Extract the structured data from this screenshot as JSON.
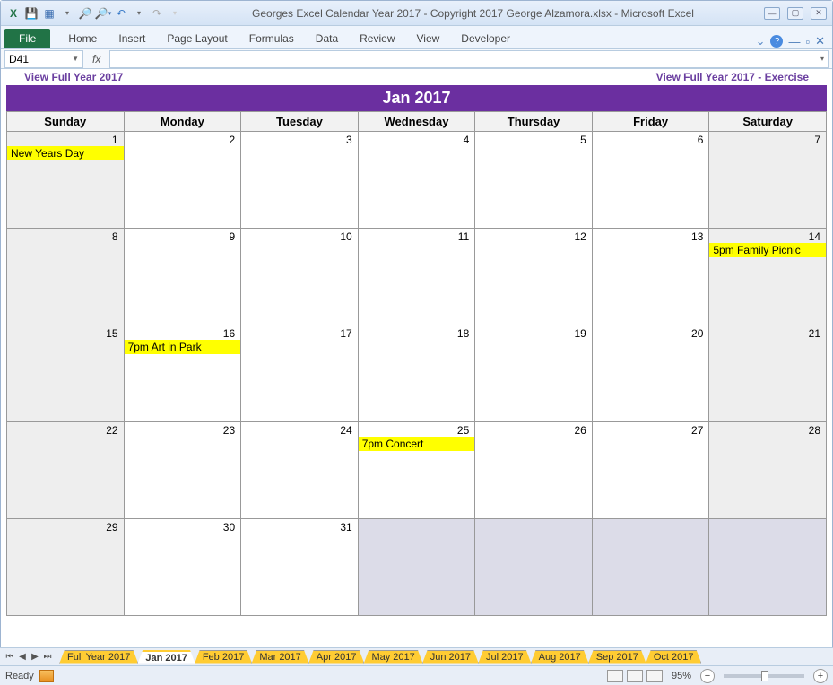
{
  "window": {
    "title": "Georges Excel Calendar Year 2017  -  Copyright 2017 George Alzamora.xlsx  -  Microsoft Excel"
  },
  "qat": {
    "excel_icon": "X",
    "save_icon": "💾",
    "undo_icon": "↶",
    "redo_icon": "↷"
  },
  "ribbon": {
    "file": "File",
    "tabs": [
      "Home",
      "Insert",
      "Page Layout",
      "Formulas",
      "Data",
      "Review",
      "View",
      "Developer"
    ]
  },
  "formula": {
    "cell_ref": "D41",
    "fx": "fx",
    "value": ""
  },
  "links": {
    "left": "View Full Year 2017",
    "right": "View Full Year 2017 - Exercise"
  },
  "month_title": "Jan 2017",
  "day_headers": [
    "Sunday",
    "Monday",
    "Tuesday",
    "Wednesday",
    "Thursday",
    "Friday",
    "Saturday"
  ],
  "weeks": [
    [
      {
        "num": "1",
        "gray": true,
        "event": "New Years Day"
      },
      {
        "num": "2",
        "gray": false
      },
      {
        "num": "3",
        "gray": false
      },
      {
        "num": "4",
        "gray": false
      },
      {
        "num": "5",
        "gray": false
      },
      {
        "num": "6",
        "gray": false
      },
      {
        "num": "7",
        "gray": true
      }
    ],
    [
      {
        "num": "8",
        "gray": true
      },
      {
        "num": "9",
        "gray": false
      },
      {
        "num": "10",
        "gray": false
      },
      {
        "num": "11",
        "gray": false
      },
      {
        "num": "12",
        "gray": false
      },
      {
        "num": "13",
        "gray": false
      },
      {
        "num": "14",
        "gray": true,
        "event": "5pm Family Picnic"
      }
    ],
    [
      {
        "num": "15",
        "gray": true
      },
      {
        "num": "16",
        "gray": false,
        "event": "7pm Art in Park"
      },
      {
        "num": "17",
        "gray": false
      },
      {
        "num": "18",
        "gray": false
      },
      {
        "num": "19",
        "gray": false
      },
      {
        "num": "20",
        "gray": false
      },
      {
        "num": "21",
        "gray": true
      }
    ],
    [
      {
        "num": "22",
        "gray": true
      },
      {
        "num": "23",
        "gray": false
      },
      {
        "num": "24",
        "gray": false
      },
      {
        "num": "25",
        "gray": false,
        "event": "7pm Concert"
      },
      {
        "num": "26",
        "gray": false
      },
      {
        "num": "27",
        "gray": false
      },
      {
        "num": "28",
        "gray": true
      }
    ],
    [
      {
        "num": "29",
        "gray": true
      },
      {
        "num": "30",
        "gray": false
      },
      {
        "num": "31",
        "gray": false
      },
      {
        "num": "",
        "fade": true
      },
      {
        "num": "",
        "fade": true
      },
      {
        "num": "",
        "fade": true
      },
      {
        "num": "",
        "fade": true
      }
    ]
  ],
  "sheet_tabs": [
    "Full Year 2017",
    "Jan 2017",
    "Feb 2017",
    "Mar 2017",
    "Apr 2017",
    "May 2017",
    "Jun 2017",
    "Jul 2017",
    "Aug 2017",
    "Sep 2017",
    "Oct 2017"
  ],
  "active_tab": "Jan 2017",
  "status": {
    "ready": "Ready",
    "zoom": "95%"
  }
}
